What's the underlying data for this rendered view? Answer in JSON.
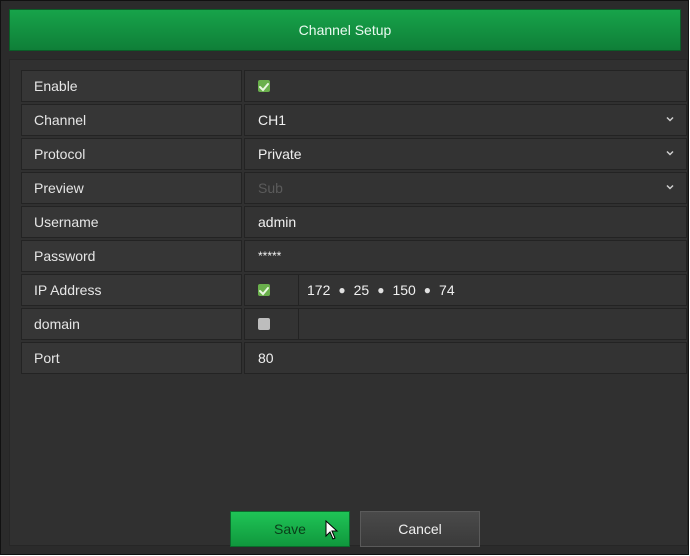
{
  "dialog": {
    "title": "Channel Setup"
  },
  "rows": [
    {
      "label": "Enable",
      "checked": true
    },
    {
      "label": "Channel",
      "value": "CH1"
    },
    {
      "label": "Protocol",
      "value": "Private"
    },
    {
      "label": "Preview",
      "value": "Sub"
    },
    {
      "label": "Username",
      "value": "admin"
    },
    {
      "label": "Password",
      "value": "*****"
    },
    {
      "label": "IP Address",
      "checked": true,
      "ip": [
        "172",
        "25",
        "150",
        "74"
      ]
    },
    {
      "label": "domain",
      "checked": false,
      "value": ""
    },
    {
      "label": "Port",
      "value": "80"
    }
  ],
  "buttons": {
    "save": "Save",
    "cancel": "Cancel"
  },
  "colors": {
    "accent": "#17a34a",
    "panel": "#303030",
    "row": "#363636"
  },
  "icons": {
    "dropdown": "chevron-down-icon",
    "cursor": "mouse-pointer-icon"
  }
}
